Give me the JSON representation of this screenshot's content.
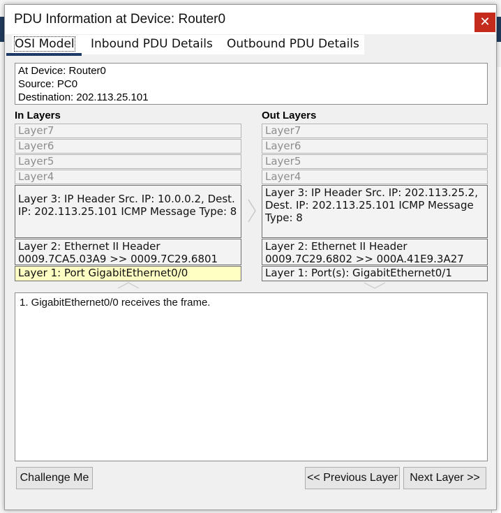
{
  "dialog": {
    "title": "PDU Information at Device: Router0",
    "close_glyph": "✕"
  },
  "tabs": [
    {
      "label": "OSI Model",
      "active": true
    },
    {
      "label": "Inbound PDU Details",
      "active": false
    },
    {
      "label": "Outbound PDU Details",
      "active": false
    }
  ],
  "info": {
    "device": "At Device: Router0",
    "source": "Source: PC0",
    "destination": "Destination: 202.113.25.101"
  },
  "in_layers": {
    "heading": "In Layers",
    "layer7": "Layer7",
    "layer6": "Layer6",
    "layer5": "Layer5",
    "layer4": "Layer4",
    "layer3": "Layer 3: IP Header Src. IP: 10.0.0.2, Dest. IP: 202.113.25.101 ICMP Message Type: 8",
    "layer2_line1": "Layer 2: Ethernet II Header",
    "layer2_line2": "0009.7CA5.03A9 >> 0009.7C29.6801",
    "layer1": "Layer 1: Port GigabitEthernet0/0"
  },
  "out_layers": {
    "heading": "Out Layers",
    "layer7": "Layer7",
    "layer6": "Layer6",
    "layer5": "Layer5",
    "layer4": "Layer4",
    "layer3": "Layer 3: IP Header Src. IP: 202.113.25.2, Dest. IP: 202.113.25.101 ICMP Message Type: 8",
    "layer2_line1": "Layer 2: Ethernet II Header",
    "layer2_line2": "0009.7C29.6802 >> 000A.41E9.3A27",
    "layer1": "Layer 1: Port(s): GigabitEthernet0/1"
  },
  "message": "1. GigabitEthernet0/0 receives the frame.",
  "buttons": {
    "challenge": "Challenge Me",
    "previous": "<< Previous Layer",
    "next": "Next Layer >>"
  },
  "colors": {
    "highlight_layer": "#ffffc4",
    "close_button": "#c42b1c",
    "tab_underline": "#1d3a66"
  },
  "icons": {
    "close": "close-icon",
    "direction": "chevron-right-icon",
    "up": "chevron-up-icon",
    "down": "chevron-down-icon"
  }
}
